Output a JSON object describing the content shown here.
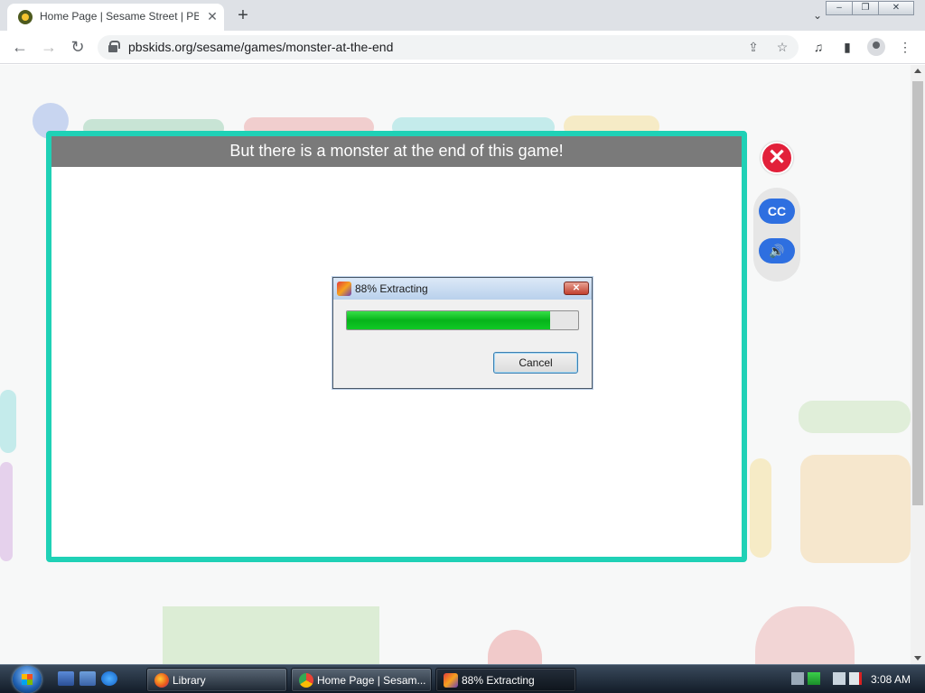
{
  "browser": {
    "tab_title": "Home Page | Sesame Street | PBS KIDS",
    "tab_close_icon": "close-icon",
    "new_tab_icon": "plus-icon",
    "url": "pbskids.org/sesame/games/monster-at-the-end"
  },
  "window_controls": {
    "minimize": "–",
    "restore": "❐",
    "close": "✕"
  },
  "nav_glyphs": {
    "back": "←",
    "forward": "→",
    "reload": "↻",
    "share": "⇪",
    "star": "☆",
    "media": "♫",
    "sidepanel": "▮",
    "menu": "⋮",
    "tabsearch": "⌄"
  },
  "game": {
    "title": "But there is a monster at the end of this game!",
    "close_glyph": "✕",
    "cc_label": "CC",
    "sound_glyph": "🔊"
  },
  "dialog": {
    "title": "88% Extracting",
    "progress": 0.88,
    "cancel_label": "Cancel",
    "close_glyph": "✕"
  },
  "taskbar": {
    "items": [
      {
        "label": "Library",
        "icon": "firefox-icon"
      },
      {
        "label": "Home Page | Sesam...",
        "icon": "chrome-icon"
      },
      {
        "label": "88% Extracting",
        "icon": "extract-icon"
      }
    ],
    "clock": "3:08 AM"
  }
}
